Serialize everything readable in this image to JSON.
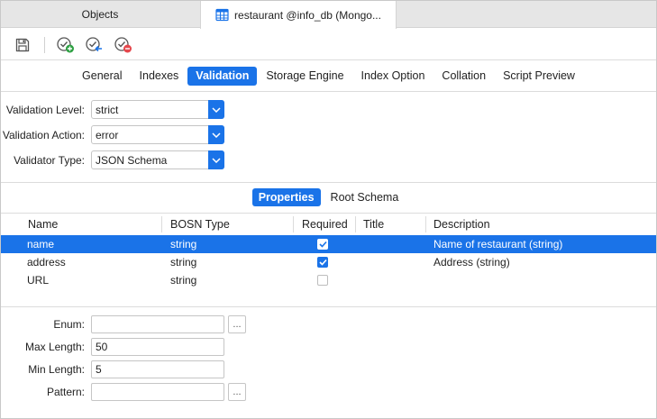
{
  "tabs": {
    "objects_label": "Objects",
    "active_label": "restaurant @info_db (Mongo..."
  },
  "toolbar": {
    "icons": [
      "save-icon",
      "check-add-icon",
      "check-left-icon",
      "check-remove-icon"
    ]
  },
  "subtabs": [
    "General",
    "Indexes",
    "Validation",
    "Storage Engine",
    "Index Option",
    "Collation",
    "Script Preview"
  ],
  "active_subtab": "Validation",
  "validation": {
    "level_label": "Validation Level:",
    "level_value": "strict",
    "action_label": "Validation Action:",
    "action_value": "error",
    "type_label": "Validator Type:",
    "type_value": "JSON Schema"
  },
  "schema_tabs": {
    "properties": "Properties",
    "root": "Root Schema",
    "active": "Properties"
  },
  "table": {
    "columns": [
      "Name",
      "BOSN Type",
      "Required",
      "Title",
      "Description"
    ],
    "rows": [
      {
        "name": "name",
        "type": "string",
        "required": true,
        "title": "",
        "description": "Name of restaurant (string)",
        "selected": true
      },
      {
        "name": "address",
        "type": "string",
        "required": true,
        "title": "",
        "description": "Address (string)",
        "selected": false
      },
      {
        "name": "URL",
        "type": "string",
        "required": false,
        "title": "",
        "description": "",
        "selected": false
      }
    ]
  },
  "fields": {
    "enum_label": "Enum:",
    "enum_value": "",
    "max_length_label": "Max Length:",
    "max_length_value": "50",
    "min_length_label": "Min Length:",
    "min_length_value": "5",
    "pattern_label": "Pattern:",
    "pattern_value": "",
    "ellipsis": "..."
  },
  "colors": {
    "accent": "#1a73e8",
    "add_green": "#2ea043",
    "remove_red": "#e5484d"
  }
}
